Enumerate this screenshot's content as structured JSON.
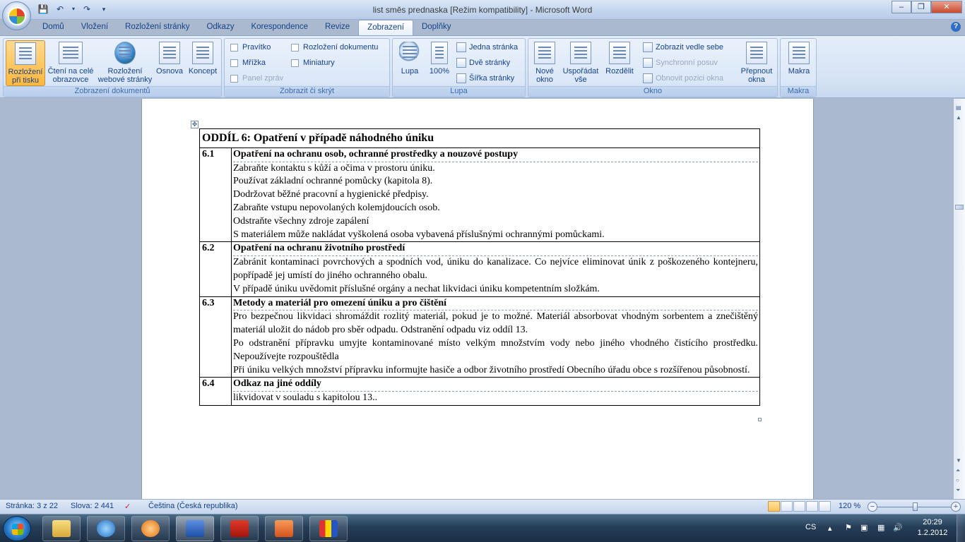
{
  "window": {
    "title": "list směs prednaska [Režim kompatibility] - Microsoft Word",
    "controls": [
      "–",
      "❐",
      "✕"
    ]
  },
  "quick_access": [
    "save-icon",
    "undo-icon",
    "redo-icon",
    "customize-icon"
  ],
  "tabs": [
    "Domů",
    "Vložení",
    "Rozložení stránky",
    "Odkazy",
    "Korespondence",
    "Revize",
    "Zobrazení",
    "Doplňky"
  ],
  "active_tab": "Zobrazení",
  "ribbon": {
    "doc_views": {
      "label": "Zobrazení dokumentů",
      "print_layout": "Rozložení při tisku",
      "full_screen": "Čtení na celé obrazovce",
      "web_layout": "Rozložení webové stránky",
      "outline": "Osnova",
      "draft": "Koncept"
    },
    "show_hide": {
      "label": "Zobrazit či skrýt",
      "ruler": "Pravítko",
      "gridlines": "Mřížka",
      "message_bar": "Panel zpráv",
      "doc_map": "Rozložení dokumentu",
      "thumbnails": "Miniatury"
    },
    "zoom": {
      "label": "Lupa",
      "zoom": "Lupa",
      "hundred": "100%",
      "one_page": "Jedna stránka",
      "two_pages": "Dvě stránky",
      "page_width": "Šířka stránky"
    },
    "window": {
      "label": "Okno",
      "new_window": "Nové okno",
      "arrange_all": "Uspořádat vše",
      "split": "Rozdělit",
      "side_by_side": "Zobrazit vedle sebe",
      "sync_scroll": "Synchronní posuv",
      "reset_pos": "Obnovit pozici okna",
      "switch": "Přepnout okna"
    },
    "macros": {
      "label": "Makra",
      "macros": "Makra"
    }
  },
  "document": {
    "heading": "ODDÍL 6: Opatření v případě náhodného úniku",
    "sections": [
      {
        "num": "6.1",
        "title": "Opatření na ochranu osob, ochranné prostředky a nouzové postupy",
        "lines": [
          "Zabraňte kontaktu s kůží a očima  v prostoru úniku.",
          "Používat základní ochranné pomůcky (kapitola 8).",
          "Dodržovat běžné pracovní a  hygienické předpisy.",
          "Zabraňte vstupu nepovolaných kolemjdoucích osob.",
          "Odstraňte všechny zdroje zapálení",
          "S materiálem může nakládat vyškolená osoba vybavená příslušnými ochrannými pomůckami."
        ]
      },
      {
        "num": "6.2",
        "title": "Opatření na ochranu životního prostředí",
        "lines": [
          "Zabránit kontaminaci povrchových a spodních vod, úniku do kanalizace.  Co nejvíce eliminovat únik z poškozeného kontejneru, popřípadě jej  umístí do jiného ochranného obalu.",
          "V případě úniku uvědomit příslušné orgány a nechat likvidaci úniku kompetentním složkám."
        ]
      },
      {
        "num": "6.3",
        "title": "Metody a materiál pro omezení úniku a pro čištění",
        "lines": [
          "Pro bezpečnou likvidaci shromáždit rozlitý materiál, pokud je to možné.  Materiál absorbovat vhodným sorbentem a znečištěný materiál uložit do nádob pro  sběr odpadu. Odstranění odpadu viz oddíl 13.",
          "Po odstranění přípravku umyjte kontaminované místo velkým množstvím vody nebo jiného vhodného čistícího prostředku. Nepoužívejte rozpouštědla",
          "Při úniku velkých množství přípravku informujte hasiče a odbor životního prostředí Obecního úřadu obce s rozšířenou působností."
        ]
      },
      {
        "num": "6.4",
        "title": "Odkaz na jiné oddíly",
        "lines": [
          "likvidovat v souladu s kapitolou 13.."
        ]
      }
    ]
  },
  "status": {
    "page": "Stránka: 3 z 22",
    "words": "Slova: 2 441",
    "language": "Čeština (Česká republika)",
    "zoom": "120 %"
  },
  "taskbar": {
    "lang": "CS",
    "time": "20:29",
    "date": "1.2.2012",
    "apps": [
      "explorer-icon",
      "internet-explorer-icon",
      "media-player-icon",
      "word-icon",
      "acrobat-icon",
      "powerpoint-icon",
      "app-icon"
    ]
  },
  "colors": {
    "ribbon_bg": "#dbe7f7",
    "tab_text": "#15428b",
    "workspace": "#abb9cf",
    "selected_button": "#ffc25a"
  }
}
